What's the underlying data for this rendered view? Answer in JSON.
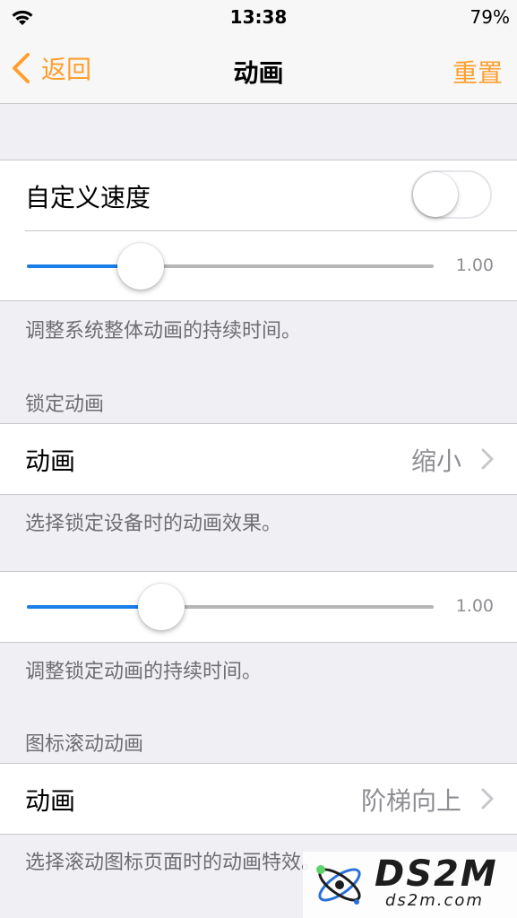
{
  "status_bar": {
    "time": "13:38",
    "battery": "79%"
  },
  "nav": {
    "back_label": "返回",
    "title": "动画",
    "right_label": "重置"
  },
  "custom_speed": {
    "label": "自定义速度",
    "toggle_on": false,
    "slider_value": 0.28,
    "slider_label": "1.00"
  },
  "system_footer": "调整系统整体动画的持续时间。",
  "lock_header": "锁定动画",
  "lock_animation": {
    "label": "动画",
    "value": "缩小"
  },
  "lock_footer": "选择锁定设备时的动画效果。",
  "lock_duration": {
    "slider_value": 0.33,
    "slider_label": "1.00"
  },
  "lock_duration_footer": "调整锁定动画的持续时间。",
  "icon_scroll_header": "图标滚动动画",
  "icon_scroll_animation": {
    "label": "动画",
    "value": "阶梯向上"
  },
  "icon_scroll_footer": "选择滚动图标页面时的动画特效。",
  "watermark": {
    "brand": "DS2M",
    "site": "ds2m.com"
  },
  "colors": {
    "accent": "#ff9f2e",
    "slider": "#1a7ee8"
  }
}
